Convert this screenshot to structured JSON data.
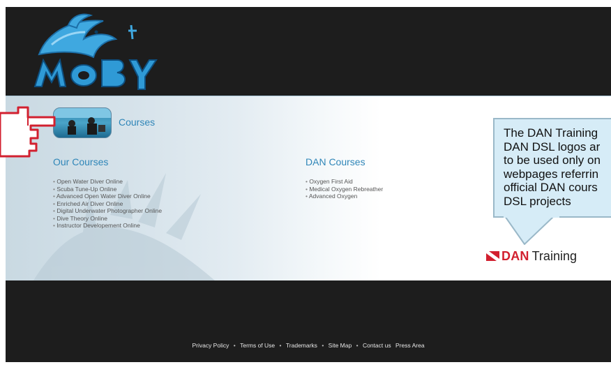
{
  "header": {
    "logo_text": "MOBY"
  },
  "section": {
    "title": "Courses"
  },
  "our_courses": {
    "title": "Our Courses",
    "items": [
      "Open Water Diver Online",
      "Scuba Tune-Up Online",
      "Advanced Open Water Diver Online",
      "Enriched Air Diver Online",
      "Digital Underwater Photographer Online",
      "Dive Theory Online",
      "Instructor Developement Online"
    ]
  },
  "dan_courses": {
    "title": "DAN Courses",
    "items": [
      "Oxygen First Aid",
      "Medical Oxygen Rebreather",
      "Advanced Oxygen"
    ]
  },
  "callout": {
    "text": "The DAN Training\nDAN DSL logos ar\nto be used only on\nwebpages referrin\nofficial DAN cours\nDSL projects"
  },
  "dan_logo": {
    "brand": "DAN",
    "suffix": "Training"
  },
  "footer": {
    "links": [
      "Privacy Policy",
      "Terms of Use",
      "Trademarks",
      "Site Map",
      "Contact us",
      "Press Area"
    ],
    "separators": [
      "•",
      "•",
      "•",
      "•"
    ]
  },
  "colors": {
    "header_bg": "#1d1d1d",
    "link_blue": "#2f86b8",
    "dan_red": "#d2202f",
    "callout_bg": "#d6ecf7"
  },
  "icons": {
    "logo": "dolphin-logo",
    "pointer": "pointing-hand-icon",
    "dan_flag": "dive-flag-icon"
  }
}
